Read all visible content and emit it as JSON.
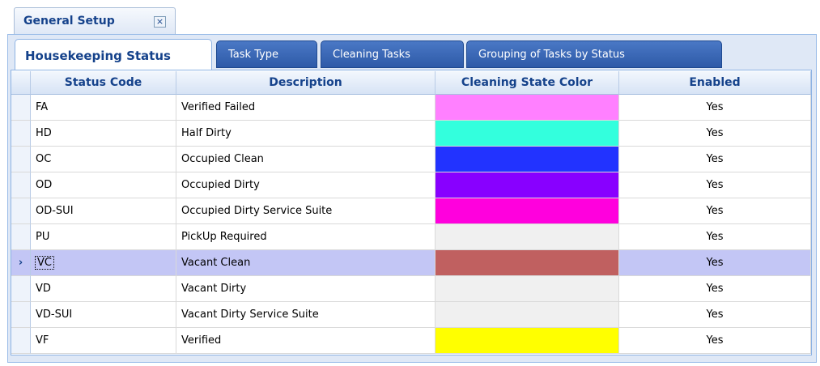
{
  "document_tab": {
    "title": "General Setup",
    "close_glyph": "×"
  },
  "tabs": [
    {
      "label": "Housekeeping Status",
      "active": true
    },
    {
      "label": "Task Type",
      "active": false
    },
    {
      "label": "Cleaning Tasks",
      "active": false
    },
    {
      "label": "Grouping of Tasks by Status",
      "active": false
    }
  ],
  "grid": {
    "columns": [
      "Status Code",
      "Description",
      "Cleaning State Color",
      "Enabled"
    ],
    "selected_row_marker": "›",
    "rows": [
      {
        "code": "FA",
        "description": "Verified Failed",
        "color": "#ff80ff",
        "enabled": "Yes",
        "selected": false
      },
      {
        "code": "HD",
        "description": "Half Dirty",
        "color": "#33ffdd",
        "enabled": "Yes",
        "selected": false
      },
      {
        "code": "OC",
        "description": "Occupied Clean",
        "color": "#2233ff",
        "enabled": "Yes",
        "selected": false
      },
      {
        "code": "OD",
        "description": "Occupied Dirty",
        "color": "#8800ff",
        "enabled": "Yes",
        "selected": false
      },
      {
        "code": "OD-SUI",
        "description": "Occupied Dirty Service Suite",
        "color": "#ff00dd",
        "enabled": "Yes",
        "selected": false
      },
      {
        "code": "PU",
        "description": "PickUp Required",
        "color": "#f0f0f0",
        "enabled": "Yes",
        "selected": false
      },
      {
        "code": "VC",
        "description": "Vacant Clean",
        "color": "#c06060",
        "enabled": "Yes",
        "selected": true
      },
      {
        "code": "VD",
        "description": "Vacant Dirty",
        "color": "#f0f0f0",
        "enabled": "Yes",
        "selected": false
      },
      {
        "code": "VD-SUI",
        "description": "Vacant Dirty Service Suite",
        "color": "#f0f0f0",
        "enabled": "Yes",
        "selected": false
      },
      {
        "code": "VF",
        "description": "Verified",
        "color": "#ffff00",
        "enabled": "Yes",
        "selected": false
      }
    ]
  }
}
